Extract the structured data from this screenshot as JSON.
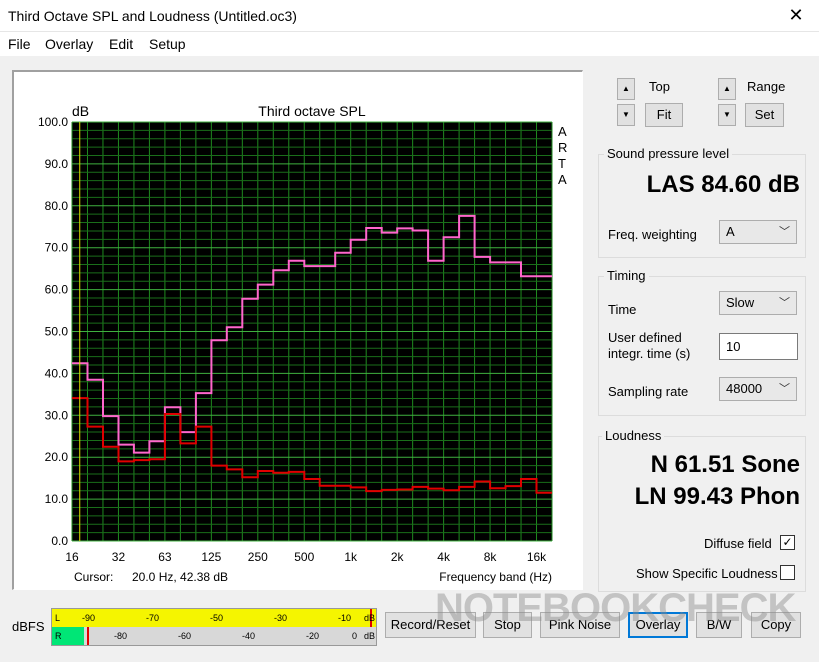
{
  "window": {
    "title": "Third Octave SPL and Loudness (Untitled.oc3)",
    "close": "✕"
  },
  "menu": [
    "File",
    "Overlay",
    "Edit",
    "Setup"
  ],
  "plot": {
    "title": "Third octave SPL",
    "ylabel": "dB",
    "side_label": [
      "A",
      "R",
      "T",
      "A"
    ],
    "cursor_label": "Cursor:",
    "cursor_value": "20.0 Hz, 42.38 dB",
    "xlabel": "Frequency band (Hz)"
  },
  "controls": {
    "top_label": "Top",
    "fit": "Fit",
    "range_label": "Range",
    "set": "Set"
  },
  "spl": {
    "group": "Sound pressure level",
    "value": "LAS 84.60 dB",
    "freq_label": "Freq. weighting",
    "freq_value": "A"
  },
  "timing": {
    "group": "Timing",
    "time_label": "Time",
    "time_value": "Slow",
    "integr_label_1": "User defined",
    "integr_label_2": "integr. time (s)",
    "integr_value": "10",
    "rate_label": "Sampling rate",
    "rate_value": "48000"
  },
  "loudness": {
    "group": "Loudness",
    "n": "N 61.51 Sone",
    "ln": "LN 99.43 Phon",
    "diffuse_label": "Diffuse field",
    "diffuse_checked": "✓",
    "specific_label": "Show Specific Loudness"
  },
  "bottom": {
    "dbfs": "dBFS",
    "meter_top": [
      "L",
      "-90",
      "-70",
      "-50",
      "-30",
      "-10",
      "dB"
    ],
    "meter_bottom": [
      "R",
      "-80",
      "-60",
      "-40",
      "-20",
      "0",
      "dB"
    ],
    "buttons": [
      "Record/Reset",
      "Stop",
      "Pink Noise",
      "Overlay",
      "B/W",
      "Copy"
    ]
  },
  "watermark": "NOTEBOOKCHECK",
  "chart_data": {
    "type": "line",
    "title": "Third octave SPL",
    "ylabel": "dB",
    "xlabel": "Frequency band (Hz)",
    "ylim": [
      0,
      100
    ],
    "yticks": [
      "100.0",
      "90.0",
      "80.0",
      "70.0",
      "60.0",
      "50.0",
      "40.0",
      "30.0",
      "20.0",
      "10.0",
      "0.0"
    ],
    "xticks": [
      "16",
      "32",
      "63",
      "125",
      "250",
      "500",
      "1k",
      "2k",
      "4k",
      "8k",
      "16k"
    ],
    "bands": [
      "20",
      "25",
      "31.5",
      "40",
      "50",
      "63",
      "80",
      "100",
      "125",
      "160",
      "200",
      "250",
      "315",
      "400",
      "500",
      "630",
      "800",
      "1k",
      "1.25k",
      "1.6k",
      "2k",
      "2.5k",
      "3.15k",
      "4k",
      "5k",
      "6.3k",
      "8k",
      "10k",
      "12.5k",
      "16k",
      "20k"
    ],
    "cursor_hz": 20,
    "grid": true,
    "series": [
      {
        "color": "#ff66cc",
        "values": [
          42.4,
          38.5,
          29.8,
          23.0,
          21.1,
          23.8,
          31.9,
          26.0,
          35.3,
          47.9,
          51.0,
          57.8,
          61.2,
          64.6,
          66.9,
          65.6,
          65.6,
          68.8,
          71.9,
          74.7,
          73.6,
          74.6,
          74.1,
          66.9,
          72.5,
          77.6,
          67.8,
          66.5,
          66.5,
          63.2,
          63.2
        ]
      },
      {
        "color": "#e00000",
        "values": [
          34.1,
          27.3,
          22.5,
          19.0,
          19.3,
          19.5,
          30.3,
          23.3,
          27.3,
          18.0,
          17.1,
          15.2,
          16.7,
          16.3,
          16.5,
          14.8,
          13.2,
          13.2,
          12.8,
          11.9,
          12.2,
          12.3,
          12.9,
          12.5,
          12.1,
          12.9,
          14.2,
          12.6,
          13.1,
          14.8,
          11.5
        ]
      }
    ]
  }
}
